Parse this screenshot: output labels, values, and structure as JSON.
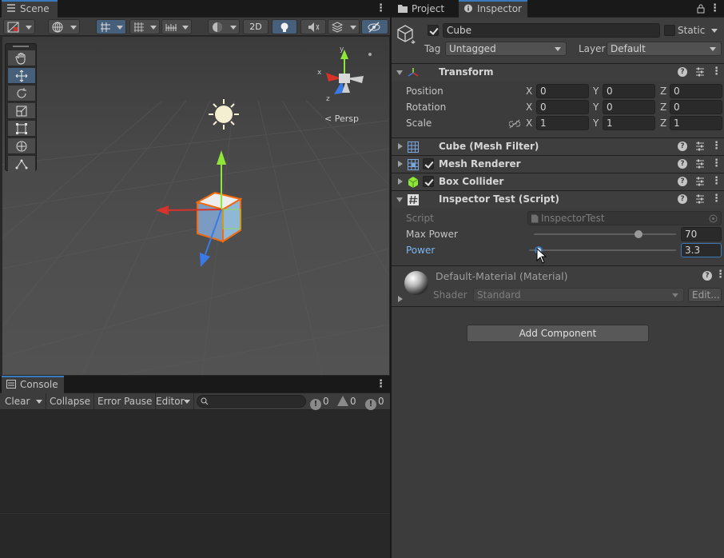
{
  "scene": {
    "tab_label": "Scene",
    "toolbar": {
      "mode_2d": "2D"
    },
    "persp_label": "< Persp",
    "gizmo_axes": {
      "x": "x",
      "y": "y",
      "z": "z"
    }
  },
  "console": {
    "tab_label": "Console",
    "clear": "Clear",
    "collapse": "Collapse",
    "error_pause": "Error Pause",
    "editor": "Editor",
    "search_placeholder": "",
    "log_count": "0",
    "warning_count": "0",
    "error_count": "0"
  },
  "right_tabs": {
    "project": "Project",
    "inspector": "Inspector"
  },
  "gameobject": {
    "name": "Cube",
    "active": true,
    "static_label": "Static",
    "tag_label": "Tag",
    "tag_value": "Untagged",
    "layer_label": "Layer",
    "layer_value": "Default"
  },
  "transform": {
    "title": "Transform",
    "position_label": "Position",
    "rotation_label": "Rotation",
    "scale_label": "Scale",
    "axis_x": "X",
    "axis_y": "Y",
    "axis_z": "Z",
    "position": {
      "x": "0",
      "y": "0",
      "z": "0"
    },
    "rotation": {
      "x": "0",
      "y": "0",
      "z": "0"
    },
    "scale": {
      "x": "1",
      "y": "1",
      "z": "1"
    }
  },
  "components": {
    "mesh_filter": "Cube (Mesh Filter)",
    "mesh_renderer": "Mesh Renderer",
    "box_collider": "Box Collider",
    "script": "Inspector Test (Script)"
  },
  "script_fields": {
    "script_label": "Script",
    "script_value": "InspectorTest",
    "max_power_label": "Max Power",
    "max_power_value": "70",
    "max_power_fraction": 0.75,
    "power_label": "Power",
    "power_value": "3.3",
    "power_fraction": 0.04
  },
  "material": {
    "title": "Default-Material (Material)",
    "shader_label": "Shader",
    "shader_value": "Standard",
    "edit_label": "Edit..."
  },
  "add_component": "Add Component",
  "colors": {
    "accent_blue": "#3a79bb",
    "selection_orange": "#f06a0f",
    "gizmo_green": "#8ee63a",
    "gizmo_red": "#d8332a",
    "gizmo_blue": "#3a7ae6"
  }
}
